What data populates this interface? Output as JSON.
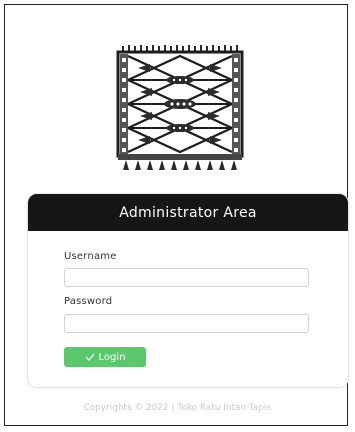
{
  "header": {
    "title": "Administrator Area"
  },
  "form": {
    "username_label": "Username",
    "username_value": "",
    "password_label": "Password",
    "password_value": "",
    "login_label": "Login"
  },
  "footer": {
    "text": "Copyrights © 2022 | Toko Ratu Intan Tapis"
  },
  "icons": {
    "logo": "tapis-cloth-logo-icon",
    "login": "check-icon"
  },
  "colors": {
    "header_bg": "#161616",
    "login_button": "#5bc86d",
    "footer_text": "#c9c9c9"
  }
}
